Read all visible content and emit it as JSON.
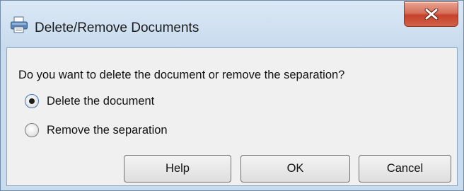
{
  "window": {
    "title": "Delete/Remove Documents",
    "title_icon": "printer-icon",
    "close_icon": "close-icon"
  },
  "dialog": {
    "question": "Do you want to delete the document or remove the separation?",
    "options": [
      {
        "label": "Delete the document",
        "selected": true
      },
      {
        "label": "Remove the separation",
        "selected": false
      }
    ]
  },
  "buttons": {
    "help": "Help",
    "ok": "OK",
    "cancel": "Cancel"
  },
  "colors": {
    "title_bg": "#c9dcee",
    "close_button": "#c6412a",
    "client_bg": "#f0f0f0"
  }
}
